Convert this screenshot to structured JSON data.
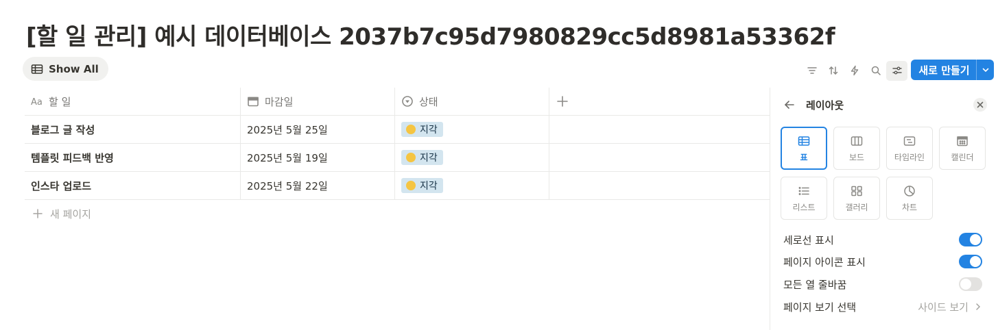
{
  "page": {
    "title": "[할 일 관리] 예시 데이터베이스 2037b7c95d7980829cc5d8981a53362f"
  },
  "view_tab": {
    "label": "Show All",
    "icon": "table-icon"
  },
  "toolbar": {
    "icons": [
      "filter-icon",
      "sort-icon",
      "lightning-icon",
      "search-icon",
      "settings-sliders-icon"
    ],
    "new_label": "새로 만들기"
  },
  "table": {
    "columns": [
      {
        "label": "할 일",
        "icon": "text-aa-icon"
      },
      {
        "label": "마감일",
        "icon": "calendar-icon"
      },
      {
        "label": "상태",
        "icon": "status-icon"
      }
    ],
    "rows": [
      {
        "task": "블로그 글 작성",
        "due": "2025년 5월 25일",
        "status": "지각"
      },
      {
        "task": "템플릿 피드백 반영",
        "due": "2025년 5월 19일",
        "status": "지각"
      },
      {
        "task": "인스타 업로드",
        "due": "2025년 5월 22일",
        "status": "지각"
      }
    ],
    "new_page_label": "새 페이지"
  },
  "panel": {
    "title": "레이아웃",
    "layouts": [
      {
        "label": "표",
        "icon": "table-icon",
        "selected": true
      },
      {
        "label": "보드",
        "icon": "board-icon",
        "selected": false
      },
      {
        "label": "타임라인",
        "icon": "timeline-icon",
        "selected": false
      },
      {
        "label": "캘린더",
        "icon": "calendar-icon",
        "selected": false
      },
      {
        "label": "리스트",
        "icon": "list-icon",
        "selected": false
      },
      {
        "label": "갤러리",
        "icon": "gallery-icon",
        "selected": false
      },
      {
        "label": "차트",
        "icon": "chart-icon",
        "selected": false
      }
    ],
    "options": [
      {
        "label": "세로선 표시",
        "on": true
      },
      {
        "label": "페이지 아이콘 표시",
        "on": true
      },
      {
        "label": "모든 열 줄바꿈",
        "on": false
      }
    ],
    "page_view": {
      "label": "페이지 보기 선택",
      "value": "사이드 보기"
    }
  },
  "colors": {
    "accent": "#2383e2",
    "status_badge_bg": "#d3e5ef",
    "status_dot": "#f5c542"
  }
}
